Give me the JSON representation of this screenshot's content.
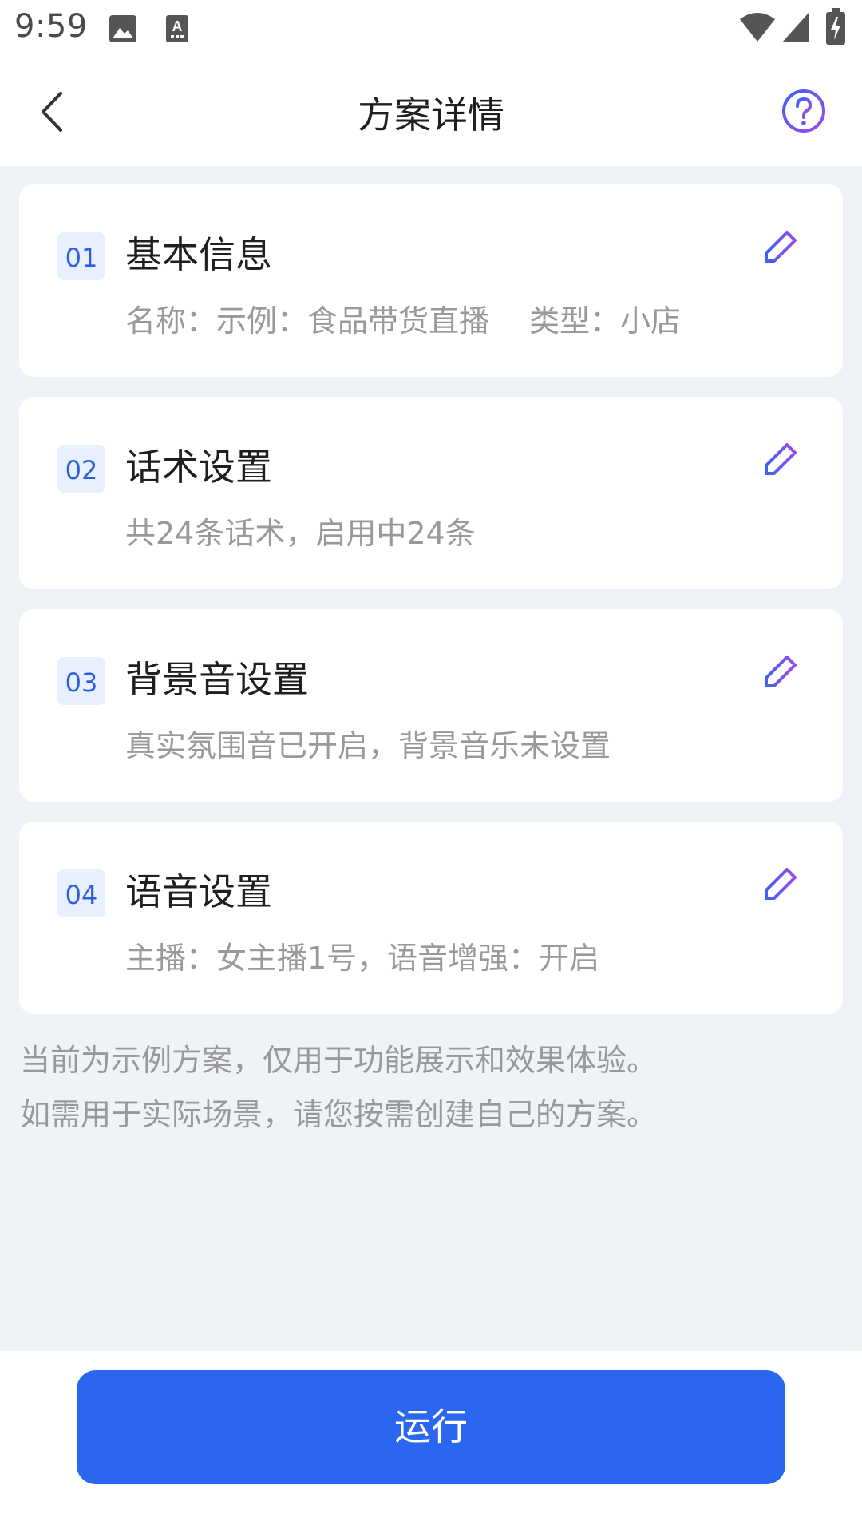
{
  "status_bar": {
    "time": "9:59",
    "icons": [
      "image-icon",
      "text-notification-icon",
      "wifi-icon",
      "signal-icon",
      "battery-icon"
    ]
  },
  "header": {
    "title": "方案详情",
    "back_icon": "chevron-left-icon",
    "help_icon": "question-circle-icon"
  },
  "cards": [
    {
      "num": "01",
      "title": "基本信息",
      "desc": "名称：示例：食品带货直播　 类型：小店",
      "edit_icon": "pencil-edit-icon"
    },
    {
      "num": "02",
      "title": "话术设置",
      "desc": "共24条话术，启用中24条",
      "edit_icon": "pencil-edit-icon"
    },
    {
      "num": "03",
      "title": "背景音设置",
      "desc": "真实氛围音已开启，背景音乐未设置",
      "edit_icon": "pencil-edit-icon"
    },
    {
      "num": "04",
      "title": "语音设置",
      "desc": "主播：女主播1号，语音增强：开启",
      "edit_icon": "pencil-edit-icon"
    }
  ],
  "note": {
    "line1": "当前为示例方案，仅用于功能展示和效果体验。",
    "line2": "如需用于实际场景，请您按需创建自己的方案。"
  },
  "run_button": {
    "label": "运行"
  },
  "colors": {
    "accent": "#2b66f0",
    "number_badge_bg": "#e8effd",
    "number_text": "#2a5fe0",
    "edit_icon_gradient": [
      "#3d63f0",
      "#9a4bf0"
    ],
    "content_bg": "#eff2f7",
    "secondary_text": "#999999"
  }
}
